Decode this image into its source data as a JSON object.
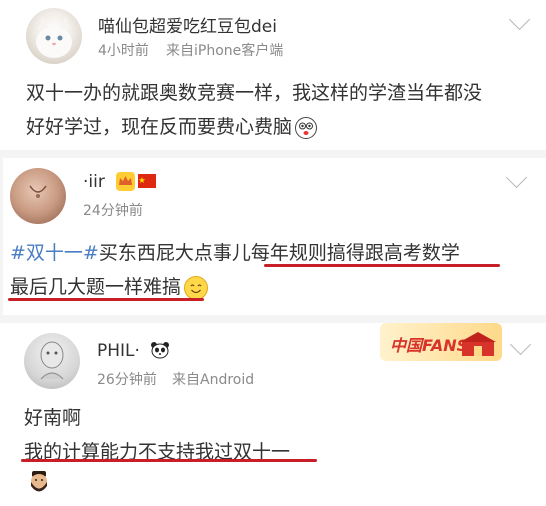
{
  "posts": [
    {
      "username": "喵仙包超爱吃红豆包dei",
      "time": "4小时前",
      "source": "来自iPhone客户端",
      "lines": [
        "双十一办的就跟奥数竞赛一样，我这样的学渣当年都没",
        "好好学过，现在反而要费心费脑"
      ],
      "emoji": "shocked-face-emoji"
    },
    {
      "username": "·iir",
      "time": "24分钟前",
      "hashtag": "#双十一#",
      "line1_rest": "买东西屁大点事儿每年规则搞得跟高考数学",
      "line2": "最后几大题一样难搞",
      "emoji": "smiling-face-emoji",
      "badges": [
        "crown-badge-icon",
        "china-flag-icon"
      ]
    },
    {
      "username": "PHIL·",
      "time": "26分钟前",
      "source": "来自Android",
      "lines": [
        "好南啊",
        "我的计算能力不支持我过双十一"
      ],
      "badge_text": "中国FANS",
      "emoji": "bearded-man-emoji",
      "badges": [
        "panda-icon"
      ]
    }
  ],
  "colors": {
    "underline": "#c81e28",
    "hashtag": "#4a7ec2",
    "meta": "#8a8a8a"
  }
}
